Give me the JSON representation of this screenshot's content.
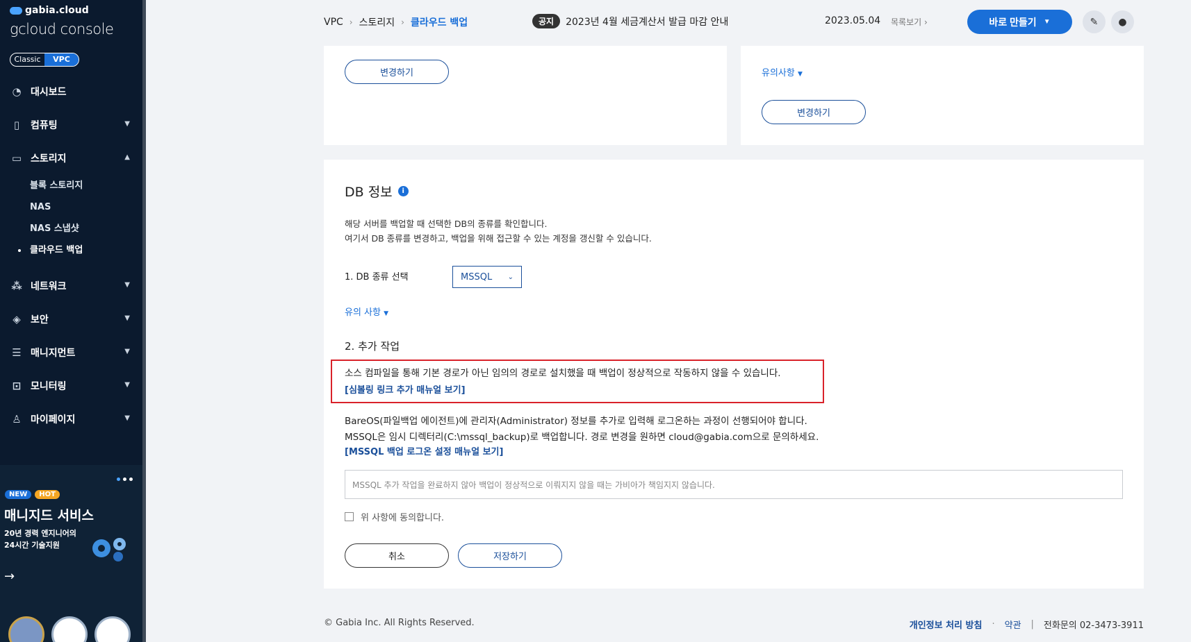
{
  "sidebar": {
    "brand_small": "gabia.cloud",
    "brand_big": "gcloud console",
    "toggle": [
      "Classic",
      "VPC"
    ],
    "nav": [
      {
        "label": "대시보드",
        "icon": "dashboard-icon"
      },
      {
        "label": "컴퓨팅",
        "icon": "chip-icon"
      },
      {
        "label": "스토리지",
        "icon": "storage-icon"
      },
      {
        "label": "네트워크",
        "icon": "network-icon"
      },
      {
        "label": "보안",
        "icon": "shield-icon"
      },
      {
        "label": "매니지먼트",
        "icon": "server-icon"
      },
      {
        "label": "모니터링",
        "icon": "monitor-icon"
      },
      {
        "label": "마이페이지",
        "icon": "user-icon"
      }
    ],
    "storage_sub": [
      "블록 스토리지",
      "NAS",
      "NAS 스냅샷",
      "클라우드 백업"
    ],
    "promo": {
      "badge_new": "NEW",
      "badge_hot": "HOT",
      "title": "매니지드 서비스",
      "subtitle": "20년 경력 엔지니어의 24시간 기술지원"
    }
  },
  "header": {
    "breadcrumb": [
      "VPC",
      "스토리지",
      "클라우드 백업"
    ],
    "notice_tag": "공지",
    "notice_text": "2023년 4월 세금계산서 발급 마감 안내",
    "notice_date": "2023.05.04",
    "notice_list": "목록보기",
    "create_button": "바로 만들기"
  },
  "top_cards": {
    "left_button": "변경하기",
    "right_caution": "유의사항",
    "right_button": "변경하기"
  },
  "db_info": {
    "title": "DB 정보",
    "desc1": "해당 서버를 백업할 때 선택한 DB의 종류를 확인합니다.",
    "desc2": "여기서 DB 종류를 변경하고, 백업을 위해 접근할 수 있는 계정을 갱신할 수 있습니다.",
    "select_label": "1. DB 종류 선택",
    "select_value": "MSSQL",
    "caution": "유의 사항",
    "section2": "2. 추가 작업",
    "warning": "소스 컴파일을 통해 기본 경로가 아닌 임의의 경로로 설치했을 때 백업이 정상적으로 작동하지 않을 수 있습니다.",
    "symlink_link": "[심볼링 링크 추가 매뉴얼 보기]",
    "para1": "BareOS(파일백업 에이전트)에 관리자(Administrator) 정보를 추가로 입력해 로그온하는 과정이 선행되어야 합니다.",
    "para2": "MSSQL은 임시 디렉터리(C:\\mssql_backup)로 백업합니다. 경로 변경을 원하면 cloud@gabia.com으로 문의하세요.",
    "logon_link": "[MSSQL 백업 로그온 설정 매뉴얼 보기]",
    "agreement_text": "MSSQL 추가 작업을 완료하지 않아 백업이 정상적으로 이뤄지지 않을 때는 가비아가 책임지지 않습니다.",
    "agree_label": "위 사항에 동의합니다.",
    "cancel": "취소",
    "save": "저장하기"
  },
  "footer": {
    "copyright": "© Gabia Inc. All Rights Reserved.",
    "privacy": "개인정보 처리 방침",
    "terms": "약관",
    "phone": "전화문의  02-3473-3911"
  }
}
